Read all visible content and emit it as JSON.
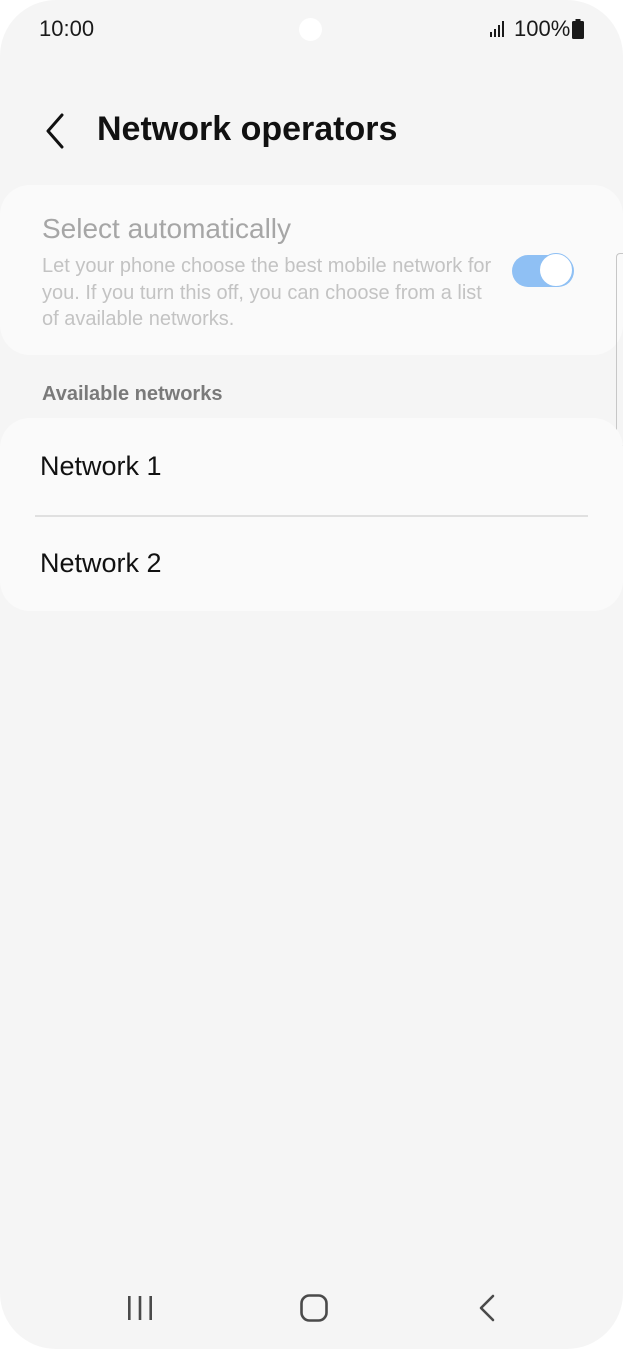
{
  "status_bar": {
    "time": "10:00",
    "battery_percent": "100%",
    "icons": [
      "camera-dot",
      "signal-icon",
      "battery-icon"
    ]
  },
  "header": {
    "title": "Network operators",
    "back_icon": "back-arrow-icon"
  },
  "select_automatically": {
    "title": "Select automatically",
    "description": "Let your phone choose the best mobile network for you. If you turn this off, you can choose from a list of available networks.",
    "toggle_on": true
  },
  "available_networks": {
    "header": "Available networks",
    "items": [
      {
        "label": "Network 1"
      },
      {
        "label": "Network 2"
      }
    ]
  },
  "nav_bar": {
    "buttons": [
      "recents-icon",
      "home-icon",
      "back-icon"
    ]
  },
  "colors": {
    "background": "#f5f5f5",
    "card": "#fafafa",
    "toggle_track": "#8fc0f4",
    "title_text": "#111111",
    "disabled_text": "#a6a6a6"
  }
}
